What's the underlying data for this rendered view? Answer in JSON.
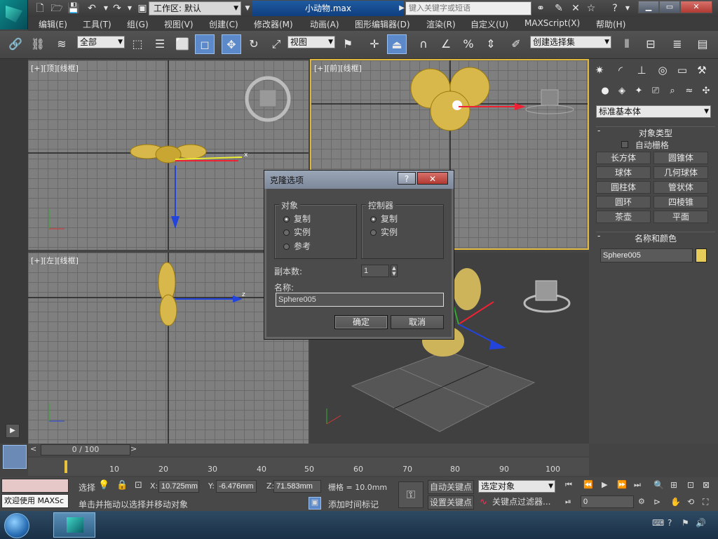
{
  "window": {
    "workspace_label": "工作区: 默认",
    "filename": "小动物.max",
    "search_placeholder": "键入关键字或短语"
  },
  "menu": [
    "编辑(E)",
    "工具(T)",
    "组(G)",
    "视图(V)",
    "创建(C)",
    "修改器(M)",
    "动画(A)",
    "图形编辑器(D)",
    "渲染(R)",
    "自定义(U)",
    "MAXScript(X)",
    "帮助(H)"
  ],
  "toolbar": {
    "selection_filter": "全部",
    "reference_coord": "视图",
    "named_selection": "创建选择集"
  },
  "viewports": {
    "top_label": "[+][顶][线框]",
    "front_label": "[+][前][线框]",
    "left_label": "[+][左][线框]"
  },
  "command_panel": {
    "category": "标准基本体",
    "object_type_title": "对象类型",
    "auto_grid_label": "自动栅格",
    "object_buttons": [
      "长方体",
      "圆锥体",
      "球体",
      "几何球体",
      "圆柱体",
      "管状体",
      "圆环",
      "四棱锥",
      "茶壶",
      "平面"
    ],
    "name_color_title": "名称和颜色",
    "object_name": "Sphere005",
    "object_color": "#e8cc5a"
  },
  "timeline": {
    "frame_display": "0 / 100",
    "ticks": [
      "10",
      "20",
      "30",
      "40",
      "50",
      "60",
      "70",
      "80",
      "90",
      "100"
    ]
  },
  "status": {
    "maxscript_welcome": "欢迎使用 MAXSc",
    "selection_label": "选择",
    "prompt": "单击并拖动以选择并移动对象",
    "x_value": "10.725mm",
    "y_value": "-6.476mm",
    "z_value": "71.583mm",
    "grid": "栅格 = 10.0mm",
    "add_time_tag": "添加时间标记",
    "auto_key": "自动关键点",
    "set_key": "设置关键点",
    "key_mode": "选定对象",
    "key_filters": "关键点过滤器...",
    "current_frame": "0"
  },
  "dialog": {
    "title": "克隆选项",
    "object_group": "对象",
    "object_options": [
      "复制",
      "实例",
      "参考"
    ],
    "object_selected": 0,
    "controller_group": "控制器",
    "controller_options": [
      "复制",
      "实例"
    ],
    "controller_selected": 0,
    "copies_label": "副本数:",
    "copies_value": "1",
    "name_label": "名称:",
    "name_value": "Sphere005",
    "ok": "确定",
    "cancel": "取消"
  }
}
